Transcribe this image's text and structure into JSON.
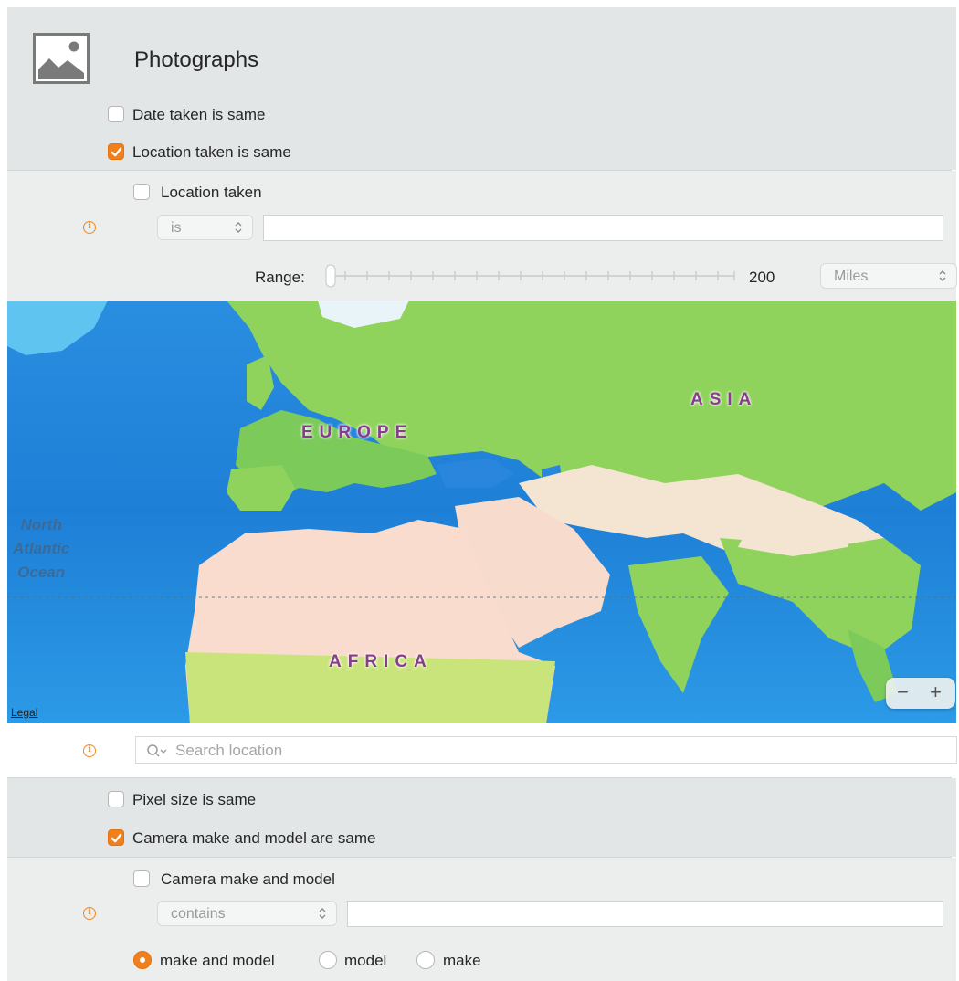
{
  "header": {
    "title": "Photographs",
    "icon": "photo-icon"
  },
  "photo_options": [
    {
      "label": "Date taken is same",
      "checked": false
    },
    {
      "label": "Location taken is same",
      "checked": true
    }
  ],
  "location": {
    "checkbox_label": "Location taken",
    "checked": false,
    "operator": "is",
    "value": "",
    "range_label": "Range:",
    "range_value": "200",
    "unit": "Miles",
    "map": {
      "labels": {
        "europe": "EUROPE",
        "asia": "ASIA",
        "africa": "AFRICA",
        "ocean": "North\nAtlantic\nOcean"
      },
      "legal": "Legal",
      "zoom_out": "−",
      "zoom_in": "+"
    },
    "search_placeholder": "Search location"
  },
  "image_options": [
    {
      "label": "Pixel size is same",
      "checked": false
    },
    {
      "label": "Camera make and model are same",
      "checked": true
    }
  ],
  "camera": {
    "checkbox_label": "Camera make and model",
    "checked": false,
    "operator": "contains",
    "value": "",
    "match_options": [
      {
        "label": "make and model",
        "selected": true
      },
      {
        "label": "model",
        "selected": false
      },
      {
        "label": "make",
        "selected": false
      }
    ]
  },
  "colors": {
    "accent": "#f0801d",
    "section_bg": "#e2e6e6",
    "info": "#ef8a26"
  }
}
